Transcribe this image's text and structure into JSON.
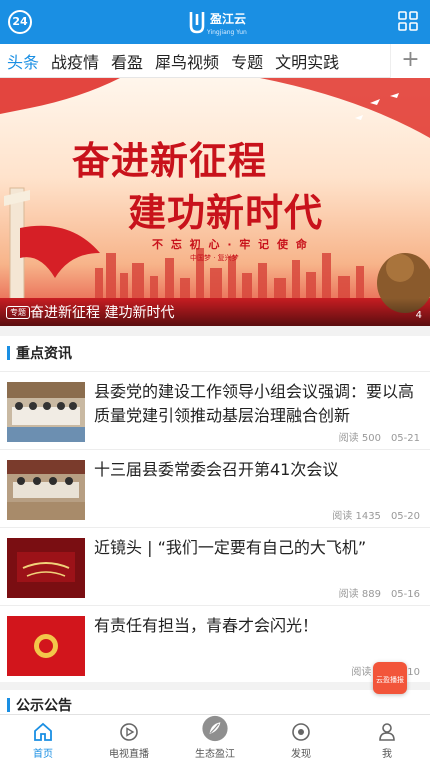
{
  "header": {
    "badge": "24",
    "logo_text": "盈江云",
    "logo_sub": "Yingjiang Yun",
    "icons": [
      "badge-24-icon",
      "logo-mark-icon",
      "grid-menu-icon"
    ]
  },
  "tabs": [
    {
      "label": "头条",
      "active": true
    },
    {
      "label": "战疫情",
      "active": false
    },
    {
      "label": "看盈",
      "active": false
    },
    {
      "label": "犀鸟视频",
      "active": false
    },
    {
      "label": "专题",
      "active": false
    },
    {
      "label": "文明实践",
      "active": false
    }
  ],
  "tab_add": "+",
  "banner": {
    "title_line1": "奋进新征程",
    "title_line2": "建功新时代",
    "subtitle": "不 忘 初 心 · 牢 记 使 命",
    "subtitle2": "中国梦 · 复兴梦",
    "tag": "专题",
    "caption": "奋进新征程 建功新时代",
    "page_indicator": "4"
  },
  "news": {
    "section_title": "重点资讯",
    "items": [
      {
        "title": "县委党的建设工作领导小组会议强调：要以高质量党建引领推动基层治理融合创新",
        "reads": "阅读 500",
        "date": "05-21"
      },
      {
        "title": "十三届县委常委会召开第41次会议",
        "reads": "阅读 1435",
        "date": "05-20"
      },
      {
        "title": "近镜头 | “我们一定要有自己的大飞机”",
        "reads": "阅读 889",
        "date": "05-16"
      },
      {
        "title": "有责任有担当，青春才会闪光！",
        "reads": "阅读 5",
        "date": "05-10"
      }
    ]
  },
  "notice": {
    "section_title": "公示公告"
  },
  "float_button": {
    "label": "云盈播报"
  },
  "bottom_nav": [
    {
      "label": "首页",
      "icon": "home-icon",
      "active": true
    },
    {
      "label": "电视直播",
      "icon": "play-circle-icon",
      "active": false
    },
    {
      "label": "生态盈江",
      "icon": "leaf-logo-icon",
      "active": false
    },
    {
      "label": "发现",
      "icon": "compass-icon",
      "active": false
    },
    {
      "label": "我",
      "icon": "person-icon",
      "active": false
    }
  ],
  "colors": {
    "brand_blue": "#1a8fe3",
    "banner_red": "#c8121b"
  }
}
